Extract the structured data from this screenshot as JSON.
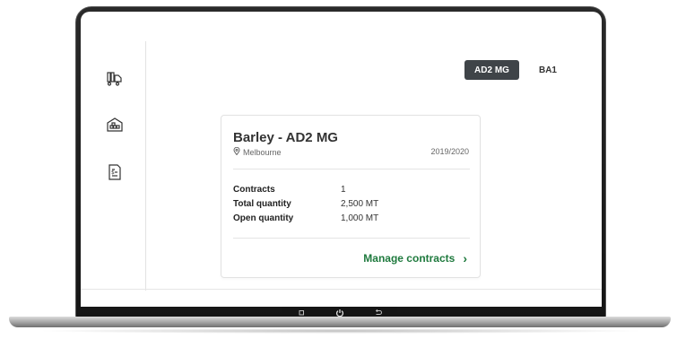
{
  "tabs": [
    {
      "label": "AD2 MG",
      "active": true
    },
    {
      "label": "BA1",
      "active": false
    }
  ],
  "sidebar": {
    "icons": [
      "trucks-icon",
      "warehouse-icon",
      "invoice-icon"
    ]
  },
  "card": {
    "title": "Barley - AD2 MG",
    "location": "Melbourne",
    "season": "2019/2020",
    "rows": [
      {
        "label": "Contracts",
        "value": "1"
      },
      {
        "label": "Total quantity",
        "value": "2,500 MT"
      },
      {
        "label": "Open quantity",
        "value": "1,000 MT"
      }
    ],
    "action_label": "Manage contracts",
    "action_chevron": "›"
  },
  "colors": {
    "accent_green": "#1f7a3e",
    "active_tab_bg": "#3f4448"
  }
}
